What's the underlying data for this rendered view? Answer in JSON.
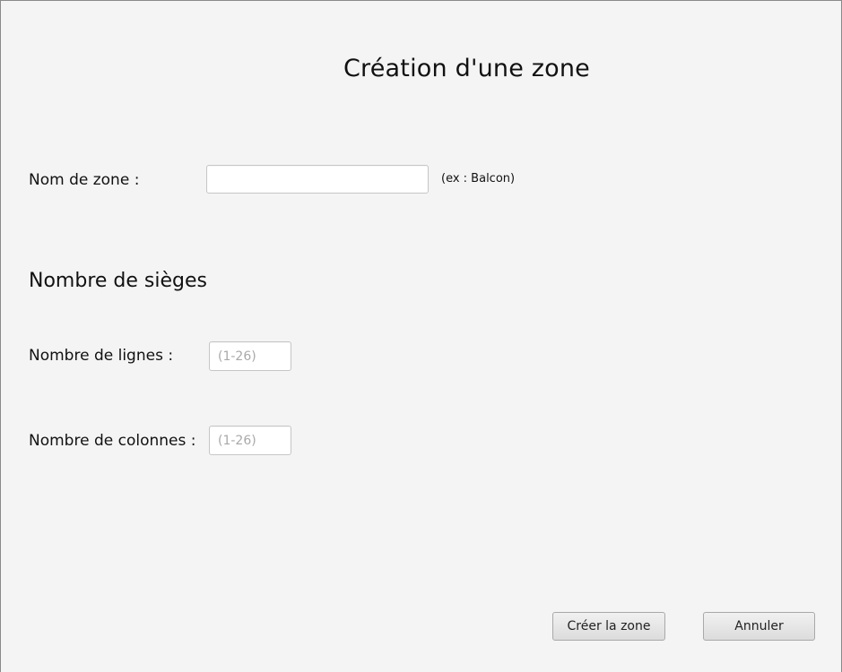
{
  "dialog": {
    "title": "Création d'une zone"
  },
  "zone_name": {
    "label": "Nom de zone :",
    "value": "",
    "placeholder": "",
    "hint": "(ex : Balcon)"
  },
  "seats": {
    "section_title": "Nombre de sièges",
    "rows": {
      "label": "Nombre de lignes :",
      "value": "",
      "placeholder": "(1-26)"
    },
    "columns": {
      "label": "Nombre de colonnes :",
      "value": "",
      "placeholder": "(1-26)"
    }
  },
  "actions": {
    "create_label": "Créer la zone",
    "cancel_label": "Annuler"
  }
}
